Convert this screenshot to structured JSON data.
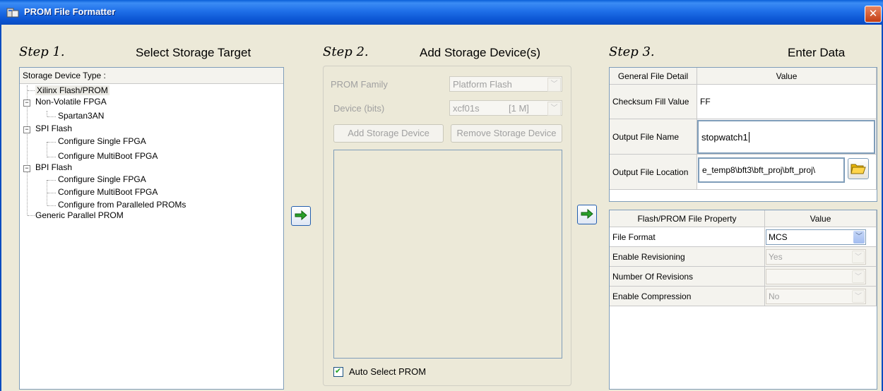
{
  "window": {
    "title": "PROM File Formatter",
    "close_glyph": "✕"
  },
  "step1": {
    "step_label": "Step 1.",
    "title": "Select Storage Target",
    "header": "Storage Device Type :",
    "tree": [
      {
        "label": "Xilinx Flash/PROM"
      },
      {
        "label": "Non-Volatile FPGA"
      },
      {
        "label": "Spartan3AN"
      },
      {
        "label": "SPI Flash"
      },
      {
        "label": "Configure Single FPGA"
      },
      {
        "label": "Configure MultiBoot FPGA"
      },
      {
        "label": "BPI Flash"
      },
      {
        "label": "Configure Single FPGA"
      },
      {
        "label": "Configure MultiBoot FPGA"
      },
      {
        "label": "Configure from Paralleled PROMs"
      },
      {
        "label": "Generic Parallel PROM"
      }
    ]
  },
  "step2": {
    "step_label": "Step 2.",
    "title": "Add Storage Device(s)",
    "prom_family_label": "PROM Family",
    "prom_family_value": "Platform Flash",
    "device_label": "Device (bits)",
    "device_value": "xcf01s",
    "device_size": "[1 M]",
    "add_button": "Add Storage Device",
    "remove_button": "Remove Storage Device",
    "auto_select_label": "Auto Select PROM"
  },
  "step3": {
    "step_label": "Step 3.",
    "title": "Enter Data",
    "general_header": {
      "col1": "General File Detail",
      "col2": "Value"
    },
    "checksum_label": "Checksum Fill Value",
    "checksum_value": "FF",
    "output_name_label": "Output File Name",
    "output_name_value": "stopwatch1",
    "output_location_label": "Output File Location",
    "output_location_value": "e_temp8\\bft3\\bft_proj\\bft_proj\\",
    "property_header": {
      "col1": "Flash/PROM File Property",
      "col2": "Value"
    },
    "file_format_label": "File Format",
    "file_format_value": "MCS",
    "enable_revisioning_label": "Enable Revisioning",
    "enable_revisioning_value": "Yes",
    "num_revisions_label": "Number Of Revisions",
    "num_revisions_value": "",
    "enable_compression_label": "Enable Compression",
    "enable_compression_value": "No"
  },
  "icons": {
    "dropdown_arrow": "﹀",
    "check_glyph": "✔"
  },
  "colors": {
    "titlebar": "#0a5fd8",
    "close": "#c23d13",
    "arrow_green": "#2aa12a"
  }
}
